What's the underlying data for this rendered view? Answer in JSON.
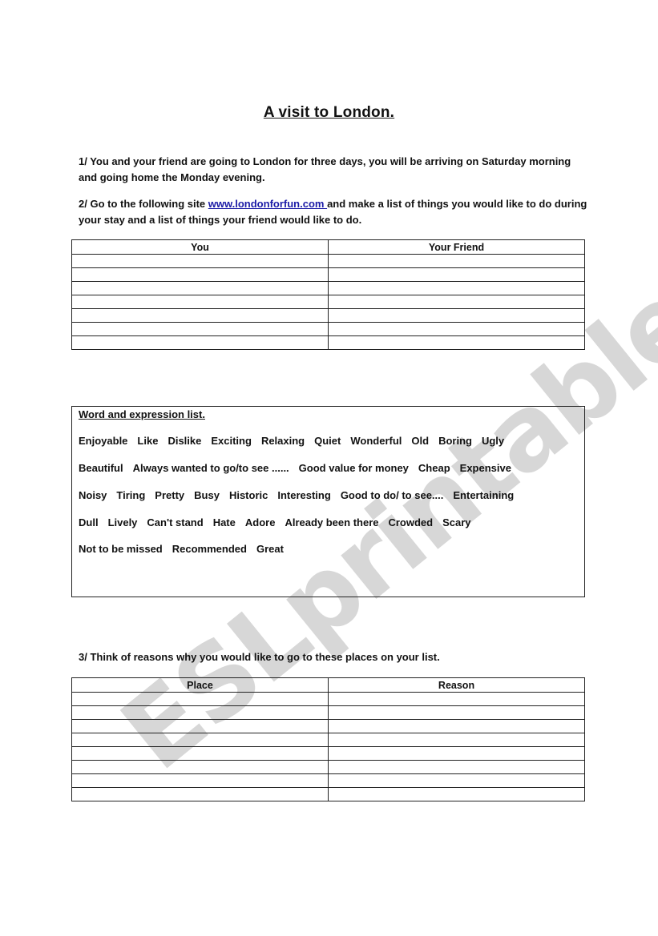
{
  "title": "A visit to London.",
  "instructions": {
    "step1": "1/  You and your friend are going to London for three days, you will be arriving on Saturday morning and going home the Monday evening.",
    "step2_before": "2/ Go to the following site ",
    "step2_link": "www.londonforfun.com ",
    "step2_after": "and  make a list of things you would like to do during your stay and a list of things your friend would like to do.",
    "step3": "3/ Think of reasons why you would like to go to these places on your list."
  },
  "table1": {
    "headers": [
      "You",
      "Your Friend"
    ],
    "empty_rows": 7
  },
  "word_list": {
    "heading": "Word and expression list.",
    "lines": [
      [
        "Enjoyable",
        "Like",
        "Dislike",
        "Exciting",
        "Relaxing",
        "Quiet",
        "Wonderful",
        "Old",
        "Boring",
        "Ugly"
      ],
      [
        "Beautiful",
        "Always wanted to go/to see ......",
        "Good value for money",
        "Cheap",
        "Expensive"
      ],
      [
        "Noisy",
        "Tiring",
        "Pretty",
        "Busy",
        "Historic",
        "Interesting",
        "Good to do/ to see....",
        "Entertaining"
      ],
      [
        "Dull",
        "Lively",
        "Can't stand",
        "Hate",
        "Adore",
        "Already been there",
        "Crowded",
        "Scary"
      ],
      [
        "Not to be missed",
        "Recommended",
        "Great"
      ]
    ]
  },
  "table2": {
    "headers": [
      "Place",
      "Reason"
    ],
    "empty_rows": 8
  },
  "watermark": "ESLprintables.com",
  "colors": {
    "link": "#1a1aa6",
    "watermark": "#969696"
  }
}
